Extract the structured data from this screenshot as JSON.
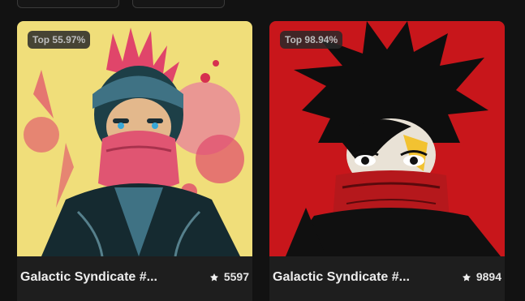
{
  "cards": [
    {
      "rank_label": "Top 55.97%",
      "title": "Galactic Syndicate #...",
      "score": "5597"
    },
    {
      "rank_label": "Top 98.94%",
      "title": "Galactic Syndicate #...",
      "score": "9894"
    }
  ],
  "colors": {
    "background": "#121212",
    "card_footer": "#1e1e1e",
    "art1_bg": "#f0de7a",
    "art1_accent": "#e04a6c",
    "art2_bg": "#c8161b"
  },
  "icons": {
    "score": "star-icon"
  }
}
